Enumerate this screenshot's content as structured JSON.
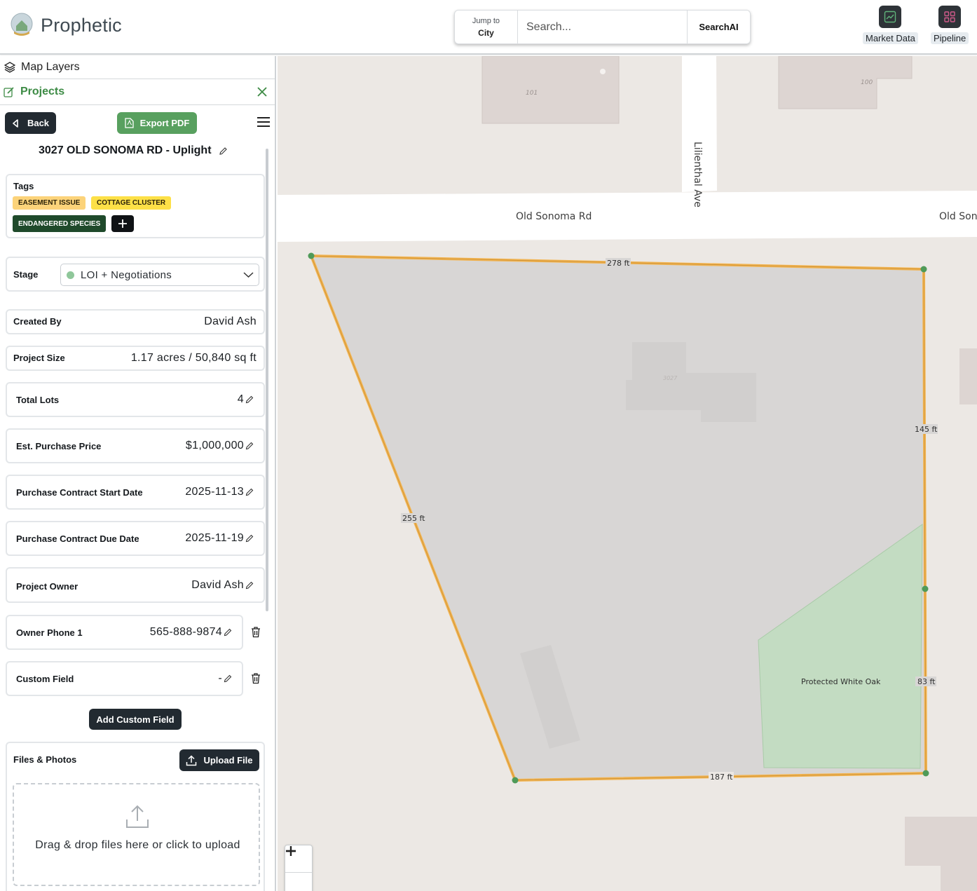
{
  "app": {
    "name": "Prophetic"
  },
  "search": {
    "jump_label": "Jump to",
    "jump_value": "City",
    "placeholder": "Search...",
    "ai_button": "SearchAI"
  },
  "top_actions": [
    {
      "label": "Market Data",
      "icon": "chart-icon"
    },
    {
      "label": "Pipeline",
      "icon": "grid-icon"
    }
  ],
  "sidebar": {
    "map_layers_label": "Map Layers",
    "projects_label": "Projects",
    "back_label": "Back",
    "export_label": "Export PDF",
    "project_title": "3027 OLD SONOMA RD - Uplight",
    "tags_label": "Tags",
    "tags": [
      {
        "label": "EASEMENT ISSUE",
        "bg": "#fcd37a",
        "fg": "#2a2108"
      },
      {
        "label": "COTTAGE CLUSTER",
        "bg": "#fde047",
        "fg": "#2a2108"
      },
      {
        "label": "ENDANGERED SPECIES",
        "bg": "#1f4a2b",
        "fg": "#ffffff"
      }
    ],
    "stage_label": "Stage",
    "stage_value": "LOI + Negotiations",
    "fields": [
      {
        "label": "Created By",
        "value": "David Ash"
      },
      {
        "label": "Project Size",
        "value": "1.17 acres / 50,840 sq ft"
      },
      {
        "label": "Total Lots",
        "value": "4"
      },
      {
        "label": "Est. Purchase Price",
        "value": "$1,000,000"
      },
      {
        "label": "Purchase Contract Start Date",
        "value": "2025-11-13"
      },
      {
        "label": "Purchase Contract Due Date",
        "value": "2025-11-19"
      },
      {
        "label": "Project Owner",
        "value": "David Ash"
      },
      {
        "label": "Owner Phone 1",
        "value": "565-888-9874"
      },
      {
        "label": "Custom Field",
        "value": "-"
      }
    ],
    "add_custom_field_label": "Add Custom Field",
    "files_label": "Files & Photos",
    "upload_label": "Upload File",
    "dropzone_text": "Drag & drop files here or click to upload"
  },
  "map": {
    "streets": [
      "Old Sonoma Rd",
      "Old Son",
      "Lilienthal Ave"
    ],
    "building_numbers": [
      "101",
      "100",
      "3027"
    ],
    "dimensions": [
      "278 ft",
      "145 ft",
      "255 ft",
      "83 ft",
      "187 ft"
    ],
    "zone_label": "Protected White Oak",
    "colors": {
      "parcel_outline": "#f2b451",
      "zone_fill": "#c3dcc2",
      "vertex": "#4f9a58"
    }
  }
}
